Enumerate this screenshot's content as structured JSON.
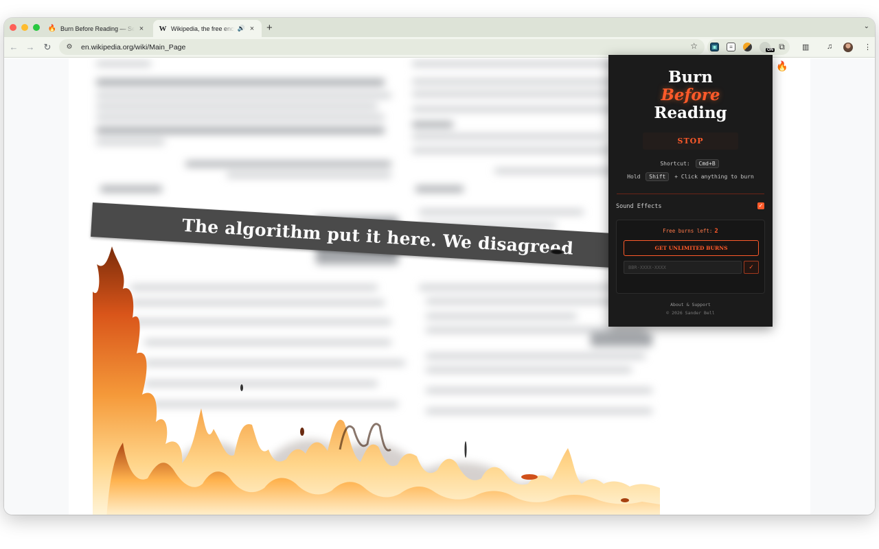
{
  "browser": {
    "tabs": [
      {
        "title": "Burn Before Reading — Set th",
        "favicon": "fire-icon",
        "active": false
      },
      {
        "title": "Wikipedia, the free encyclo",
        "favicon": "wikipedia-w-icon",
        "active": true,
        "audio": true
      }
    ],
    "new_tab_label": "+",
    "url": "en.wikipedia.org/wiki/Main_Page",
    "extension_badge": "ON"
  },
  "page": {
    "banner_text": "The algorithm put it here. We disagreed"
  },
  "popup": {
    "brand": {
      "line1": "Burn",
      "line2": "Before",
      "line3": "Reading"
    },
    "stop_label": "STOP",
    "shortcut_label": "Shortcut:",
    "shortcut_key": "Cmd+B",
    "hold_label": "Hold",
    "hold_key": "Shift",
    "hold_suffix": "+ Click anything to burn",
    "sound_label": "Sound Effects",
    "sound_enabled": true,
    "free_burns_label": "Free burns left:",
    "free_burns_count": "2",
    "unlimited_label": "GET UNLIMITED BURNS",
    "license_placeholder": "BBR-XXXX-XXXX",
    "license_submit": "✓",
    "about_label": "About & Support",
    "copyright": "© 2026 Sander Bell"
  },
  "colors": {
    "accent": "#ff5a2a",
    "popup_bg": "#1b1b1b",
    "banner_bg": "#4a4a4a"
  }
}
